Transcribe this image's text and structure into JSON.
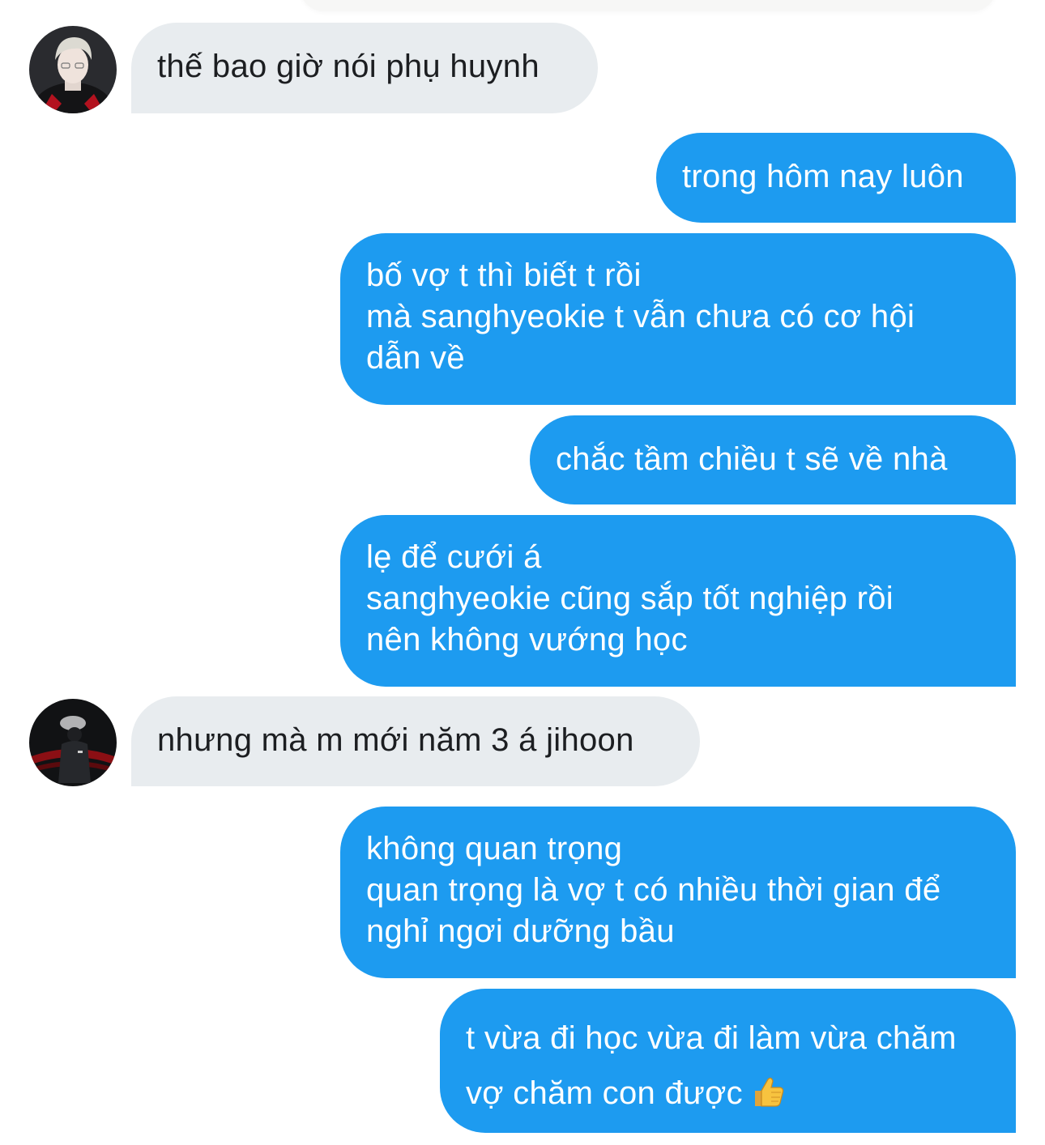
{
  "conversation": {
    "messages": [
      {
        "direction": "incoming",
        "lines": [
          "thế bao giờ nói phụ huynh"
        ]
      },
      {
        "direction": "outgoing",
        "lines": [
          "trong hôm nay luôn"
        ]
      },
      {
        "direction": "outgoing",
        "lines": [
          "bố vợ t thì biết t rồi",
          "mà sanghyeokie t vẫn chưa có cơ hội",
          "dẫn về"
        ]
      },
      {
        "direction": "outgoing",
        "lines": [
          "chắc tầm chiều t sẽ về nhà"
        ]
      },
      {
        "direction": "outgoing",
        "lines": [
          "lẹ để cưới á",
          "sanghyeokie cũng sắp tốt nghiệp rồi",
          "nên không vướng học"
        ]
      },
      {
        "direction": "incoming",
        "lines": [
          "nhưng mà m mới năm 3 á jihoon"
        ]
      },
      {
        "direction": "outgoing",
        "lines": [
          "không quan trọng",
          "quan trọng là vợ t có nhiều thời gian để",
          "nghỉ ngơi dưỡng bầu"
        ]
      },
      {
        "direction": "outgoing",
        "lines": [
          "t vừa đi học vừa đi làm vừa chăm",
          "vợ chăm con được"
        ],
        "emoji": "thumbs-up-emoji"
      }
    ]
  },
  "colors": {
    "outgoing_bubble": "#1d9bf0",
    "incoming_bubble": "#e8ecef",
    "outgoing_text": "#ffffff",
    "incoming_text": "#1c1e21"
  }
}
